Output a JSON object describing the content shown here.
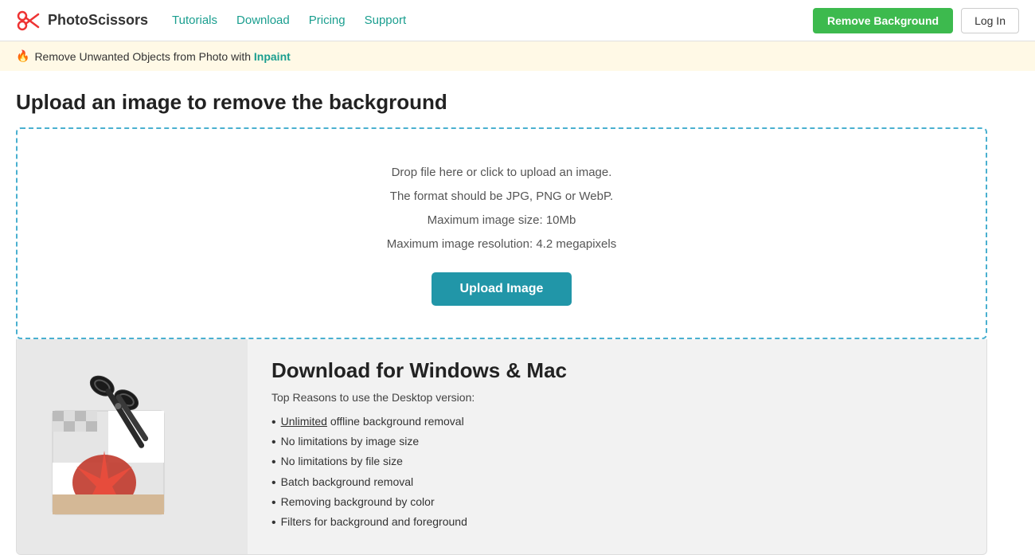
{
  "header": {
    "logo_text": "PhotoScissors",
    "nav": [
      {
        "label": "Tutorials",
        "id": "tutorials"
      },
      {
        "label": "Download",
        "id": "download"
      },
      {
        "label": "Pricing",
        "id": "pricing"
      },
      {
        "label": "Support",
        "id": "support"
      }
    ],
    "remove_bg_button": "Remove Background",
    "login_button": "Log In"
  },
  "banner": {
    "text": "Remove Unwanted Objects from Photo with",
    "link_label": "Inpaint"
  },
  "main": {
    "page_title": "Upload an image to remove the background",
    "upload_area": {
      "line1": "Drop file here or click to upload an image.",
      "line2": "The format should be JPG, PNG or WebP.",
      "line3": "Maximum image size: 10Mb",
      "line4": "Maximum image resolution: 4.2 megapixels",
      "button_label": "Upload Image"
    },
    "download_section": {
      "title": "Download for Windows & Mac",
      "subtitle": "Top Reasons to use the Desktop version:",
      "features": [
        {
          "text": "Unlimited",
          "underline": true,
          "rest": " offline background removal"
        },
        {
          "text": "No limitations by image size",
          "underline": false,
          "rest": ""
        },
        {
          "text": "No limitations by file size",
          "underline": false,
          "rest": ""
        },
        {
          "text": "Batch background removal",
          "underline": false,
          "rest": ""
        },
        {
          "text": "Removing background by color",
          "underline": false,
          "rest": ""
        },
        {
          "text": "Filters for background and foreground",
          "underline": false,
          "rest": ""
        }
      ]
    }
  }
}
